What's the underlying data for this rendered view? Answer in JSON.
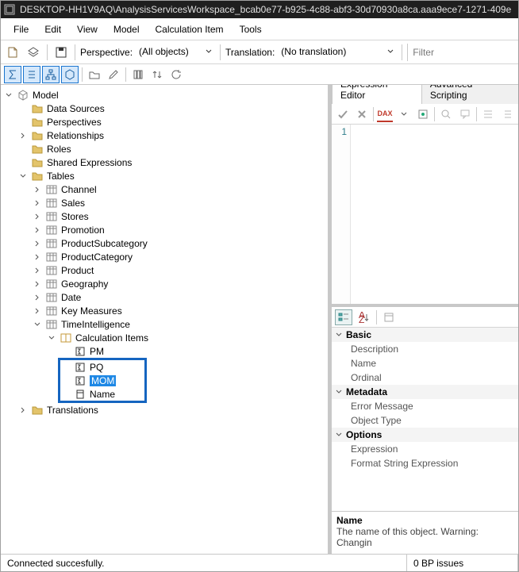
{
  "title": "DESKTOP-HH1V9AQ\\AnalysisServicesWorkspace_bcab0e77-b925-4c88-abf3-30d70930a8ca.aaa9ece7-1271-409e",
  "menu": {
    "file": "File",
    "edit": "Edit",
    "view": "View",
    "model": "Model",
    "calcitem": "Calculation Item",
    "tools": "Tools"
  },
  "opts": {
    "perspective_label": "Perspective:",
    "perspective_value": "(All objects)",
    "translation_label": "Translation:",
    "translation_value": "(No translation)",
    "filter_placeholder": "Filter"
  },
  "tree": {
    "root": "Model",
    "data_sources": "Data Sources",
    "perspectives": "Perspectives",
    "relationships": "Relationships",
    "roles": "Roles",
    "shared_exprs": "Shared Expressions",
    "tables": "Tables",
    "tables_list": {
      "channel": "Channel",
      "sales": "Sales",
      "stores": "Stores",
      "promotion": "Promotion",
      "prodsubcat": "ProductSubcategory",
      "prodcat": "ProductCategory",
      "product": "Product",
      "geography": "Geography",
      "date": "Date",
      "keymeas": "Key Measures",
      "timeint": "TimeIntelligence"
    },
    "calc_items": "Calculation Items",
    "ci": {
      "pm": "PM",
      "pq": "PQ",
      "mom": "MOM",
      "name": "Name"
    },
    "translations": "Translations"
  },
  "right": {
    "tab_expr": "Expression Editor",
    "tab_adv": "Advanced Scripting",
    "dax_label": "DAX",
    "gutter1": "1"
  },
  "props": {
    "cat_basic": "Basic",
    "desc": "Description",
    "name": "Name",
    "ordinal": "Ordinal",
    "cat_meta": "Metadata",
    "err": "Error Message",
    "objtype": "Object Type",
    "cat_opts": "Options",
    "expr": "Expression",
    "fse": "Format String Expression",
    "help_name": "Name",
    "help_text": "The name of this object. Warning: Changin"
  },
  "status": {
    "conn": "Connected succesfully.",
    "bp": "0 BP issues"
  }
}
